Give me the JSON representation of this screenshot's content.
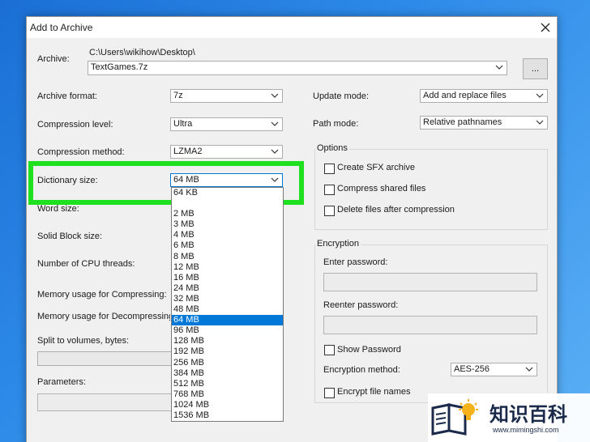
{
  "dialog": {
    "title": "Add to Archive",
    "archive": {
      "label": "Archive:",
      "path": "C:\\Users\\wikihow\\Desktop\\",
      "filename": "TextGames.7z",
      "browse_label": "..."
    },
    "left": {
      "archive_format": {
        "label": "Archive format:",
        "value": "7z"
      },
      "compression_level": {
        "label": "Compression level:",
        "value": "Ultra"
      },
      "compression_method": {
        "label": "Compression method:",
        "value": "LZMA2"
      },
      "dictionary_size": {
        "label": "Dictionary size:",
        "value": "64 MB"
      },
      "word_size": {
        "label": "Word size:"
      },
      "solid_block_size": {
        "label": "Solid Block size:"
      },
      "cpu_threads": {
        "label": "Number of CPU threads:"
      },
      "memory_compress": {
        "label": "Memory usage for Compressing:"
      },
      "memory_decompress": {
        "label": "Memory usage for Decompressing:"
      },
      "split_volumes": {
        "label": "Split to volumes, bytes:"
      },
      "parameters": {
        "label": "Parameters:"
      }
    },
    "right": {
      "update_mode": {
        "label": "Update mode:",
        "value": "Add and replace files"
      },
      "path_mode": {
        "label": "Path mode:",
        "value": "Relative pathnames"
      },
      "options": {
        "title": "Options",
        "create_sfx": "Create SFX archive",
        "compress_shared": "Compress shared files",
        "delete_after": "Delete files after compression"
      },
      "encryption": {
        "title": "Encryption",
        "enter_password": "Enter password:",
        "reenter_password": "Reenter password:",
        "show_password": "Show Password",
        "method_label": "Encryption method:",
        "method_value": "AES-256",
        "encrypt_names": "Encrypt file names"
      }
    },
    "dictionary_dropdown": {
      "options": [
        "64 KB",
        "",
        "2 MB",
        "3 MB",
        "4 MB",
        "6 MB",
        "8 MB",
        "12 MB",
        "16 MB",
        "24 MB",
        "32 MB",
        "48 MB",
        "64 MB",
        "96 MB",
        "128 MB",
        "192 MB",
        "256 MB",
        "384 MB",
        "512 MB",
        "768 MB",
        "1024 MB",
        "1536 MB"
      ],
      "selected": "64 MB"
    },
    "highlight_color": "#1fe01f"
  },
  "watermark": {
    "brand": "知识百科",
    "url": "www.mimingshi.com"
  },
  "icons": [
    "close-icon",
    "chevron-down-icon",
    "book-lightbulb-icon"
  ]
}
